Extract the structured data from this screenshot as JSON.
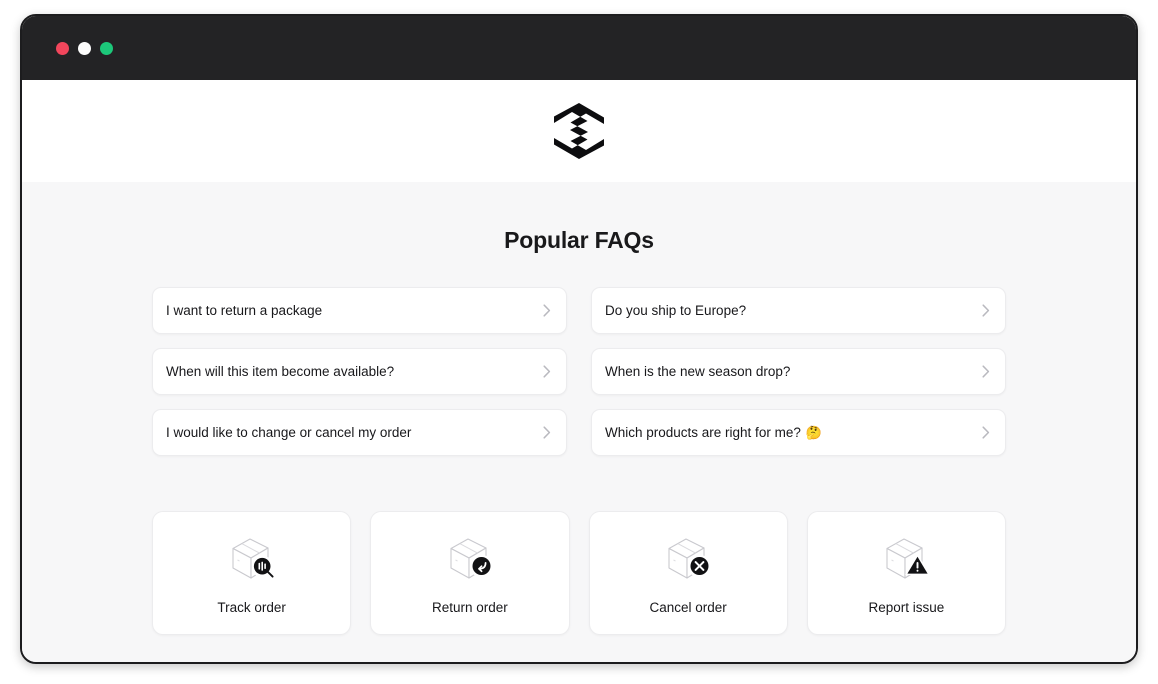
{
  "window": {
    "titlebar": {
      "controls": [
        {
          "name": "close",
          "color": "#f2465c"
        },
        {
          "name": "minimize",
          "color": "#fdfdfd"
        },
        {
          "name": "maximize",
          "color": "#1cc87a"
        }
      ]
    },
    "brand": {
      "logo_icon": "hexagon-s-logo-icon",
      "logo_color": "#0d0d0f"
    }
  },
  "main": {
    "title": "Popular FAQs",
    "faqs": [
      {
        "label": "I want to return a package",
        "emoji": "",
        "chevron_icon": "chevron-right-icon"
      },
      {
        "label": "Do you ship to Europe?",
        "emoji": "",
        "chevron_icon": "chevron-right-icon"
      },
      {
        "label": "When will this item become available?",
        "emoji": "",
        "chevron_icon": "chevron-right-icon"
      },
      {
        "label": "When is the new season drop?",
        "emoji": "",
        "chevron_icon": "chevron-right-icon"
      },
      {
        "label": "I would like to change or cancel my order",
        "emoji": "",
        "chevron_icon": "chevron-right-icon"
      },
      {
        "label": "Which products are right for me?",
        "emoji": "🤔",
        "chevron_icon": "chevron-right-icon"
      }
    ],
    "actions": [
      {
        "label": "Track order",
        "icon": "box-with-magnifier-icon"
      },
      {
        "label": "Return order",
        "icon": "box-with-return-arrow-icon"
      },
      {
        "label": "Cancel order",
        "icon": "box-with-cross-icon"
      },
      {
        "label": "Report issue",
        "icon": "box-with-warning-icon"
      }
    ]
  },
  "colors": {
    "titlebar": "#232325",
    "page_background": "#f7f7f8",
    "card_background": "#ffffff",
    "card_border": "#ececee",
    "text_primary": "#18181b",
    "chevron": "#b9b9bf"
  }
}
